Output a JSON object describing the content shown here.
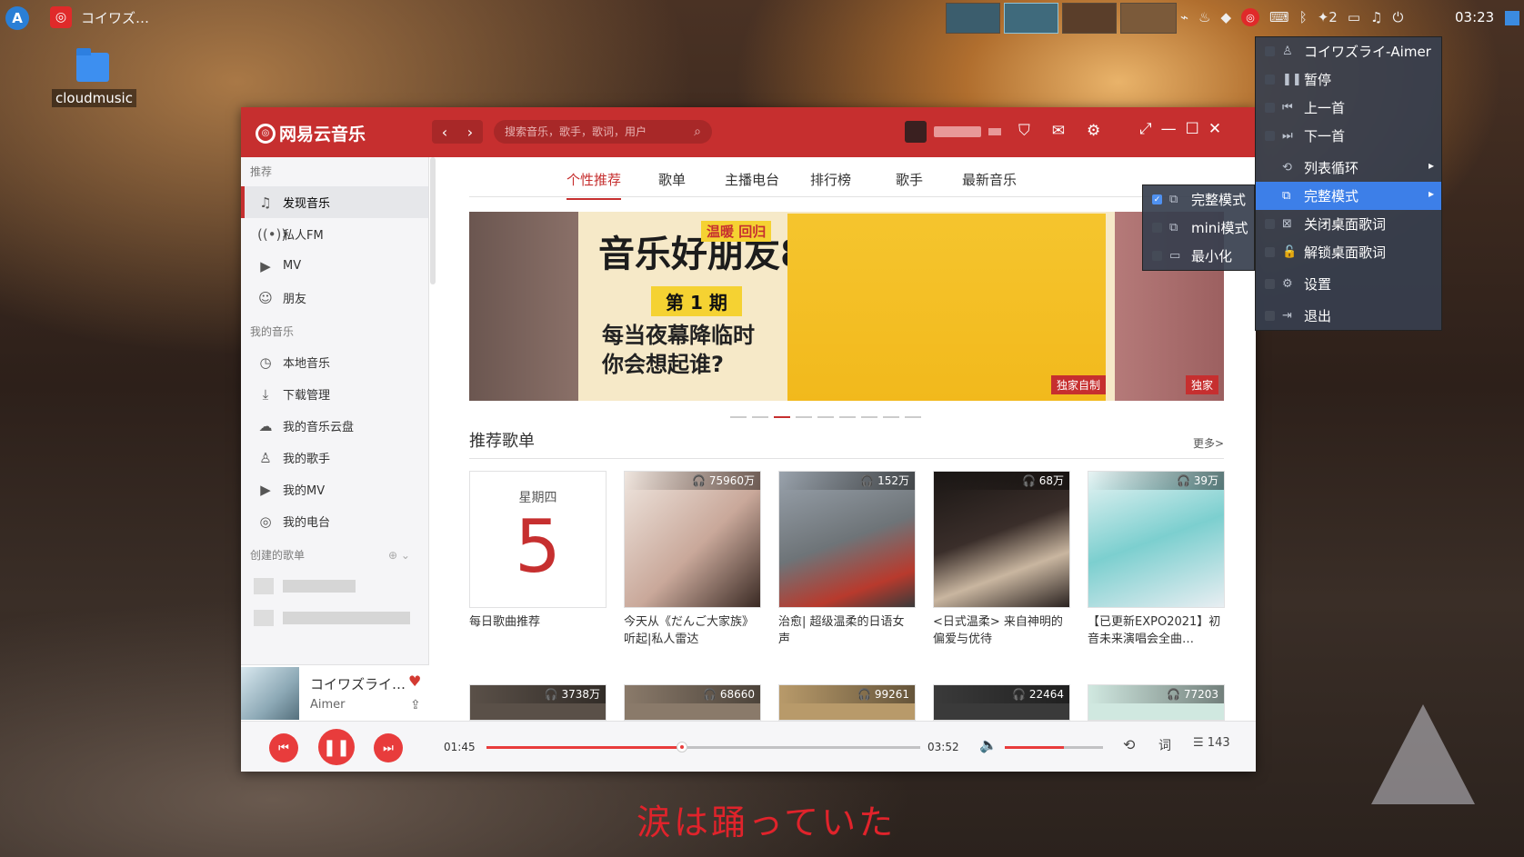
{
  "taskbar": {
    "app_title": "コイワズ…",
    "clock": "03:23",
    "notif_count": "2"
  },
  "desktop": {
    "icon_label": "cloudmusic"
  },
  "window": {
    "logo": "网易云音乐",
    "search_placeholder": "搜索音乐，歌手，歌词，用户",
    "tabs": [
      "个性推荐",
      "歌单",
      "主播电台",
      "排行榜",
      "歌手",
      "最新音乐"
    ],
    "sidebar": {
      "sec1": "推荐",
      "items1": [
        "发现音乐",
        "私人FM",
        "MV",
        "朋友"
      ],
      "sec2": "我的音乐",
      "items2": [
        "本地音乐",
        "下载管理",
        "我的音乐云盘",
        "我的歌手",
        "我的MV",
        "我的电台"
      ],
      "sec3": "创建的歌单"
    },
    "banner": {
      "title": "音乐好朋友",
      "num": "8",
      "tag": "温暖 回归",
      "episode": "第 1 期",
      "slogan": "每当夜幕降临时 你会想起谁?",
      "badge_center": "独家自制",
      "badge_right": "独家"
    },
    "section": {
      "title": "推荐歌单",
      "more": "更多>"
    },
    "calendar": {
      "weekday": "星期四",
      "day": "5"
    },
    "cards": [
      {
        "plays": "每日歌曲推荐",
        "caption": "每日歌曲推荐"
      },
      {
        "plays": "75960万",
        "caption": "今天从《だんご大家族》听起|私人雷达"
      },
      {
        "plays": "152万",
        "caption": "治愈| 超级温柔的日语女声"
      },
      {
        "plays": "68万",
        "caption": "<日式温柔> 来自神明的偏爱与优待"
      },
      {
        "plays": "39万",
        "caption": "【已更新EXPO2021】初音未来演唱会全曲…"
      }
    ],
    "cards_row2": [
      "3738万",
      "68660",
      "99261",
      "22464",
      "77203"
    ],
    "mini_player": {
      "title": "コイワズライ…",
      "artist": "Aimer"
    },
    "player": {
      "elapsed": "01:45",
      "total": "03:52",
      "lyric_btn": "词",
      "playlist_count": "143",
      "progress": 0.45,
      "volume": 0.6
    }
  },
  "tray_menu": {
    "items": [
      "コイワズライ-Aimer",
      "暂停",
      "上一首",
      "下一首",
      "列表循环",
      "完整模式",
      "关闭桌面歌词",
      "解锁桌面歌词",
      "设置",
      "退出"
    ]
  },
  "sub_menu": {
    "items": [
      "完整模式",
      "mini模式",
      "最小化"
    ]
  },
  "desktop_lyric": "涙は踊っていた",
  "colors": {
    "brand": "#c62f2f",
    "menu_highlight": "#3d7fe8",
    "lyric": "#e0232b"
  }
}
